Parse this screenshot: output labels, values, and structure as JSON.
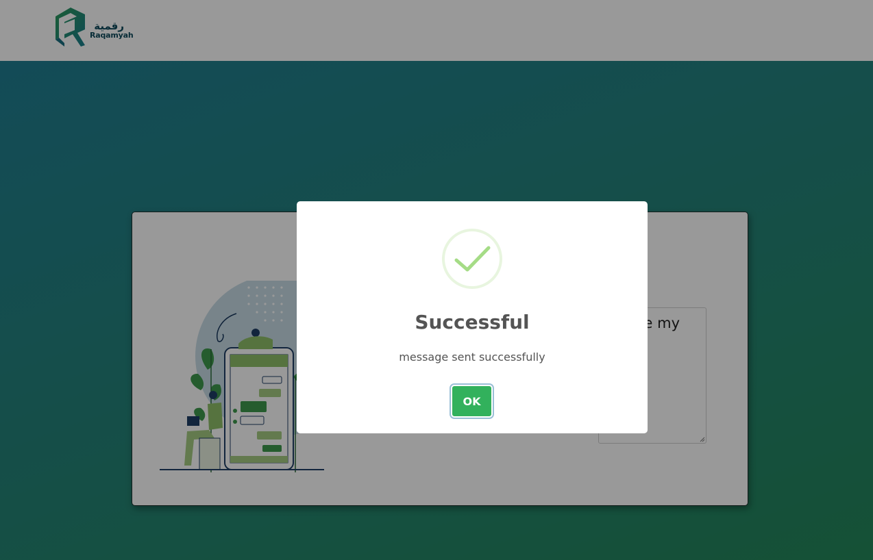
{
  "header": {
    "logo_arabic": "رقمية",
    "logo_latin": "Raqamyah"
  },
  "contact": {
    "message_text": "e my"
  },
  "dialog": {
    "title": "Successful",
    "message": "message sent successfully",
    "ok_label": "OK"
  },
  "colors": {
    "brand_teal": "#1b8a8d",
    "brand_green": "#3a9a5b",
    "ok_button": "#32b15c",
    "success_check": "#a5dc86"
  },
  "icons": {
    "success": "checkmark-circle-icon",
    "logo": "raqamyah-logo-icon"
  }
}
